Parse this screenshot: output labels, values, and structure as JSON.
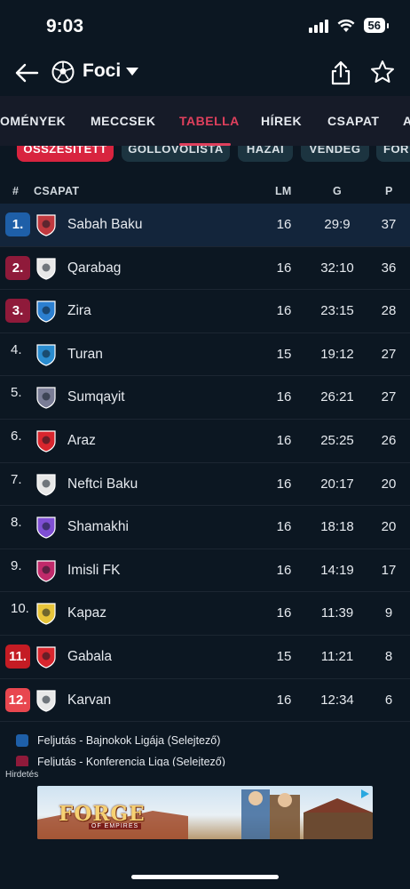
{
  "status_bar": {
    "time": "9:03",
    "battery": "56"
  },
  "header": {
    "title": "Foci"
  },
  "tabs": [
    {
      "label": "OMÉNYEK"
    },
    {
      "label": "MECCSEK"
    },
    {
      "label": "TABELLA"
    },
    {
      "label": "HÍREK"
    },
    {
      "label": "CSAPAT"
    },
    {
      "label": "A"
    }
  ],
  "chips": [
    {
      "label": "ÖSSZESÍTETT"
    },
    {
      "label": "GÓLLÖVŐLISTA"
    },
    {
      "label": "HAZAI"
    },
    {
      "label": "VENDÉG"
    },
    {
      "label": "FOR"
    }
  ],
  "table": {
    "headers": {
      "rank": "#",
      "team": "CSAPAT",
      "played": "LM",
      "goals": "G",
      "points": "P"
    },
    "rows": [
      {
        "pos": "1.",
        "team": "Sabah Baku",
        "lm": "16",
        "g": "29:9",
        "p": "37",
        "badge_color": "#1e5fa8",
        "highlight": true
      },
      {
        "pos": "2.",
        "team": "Qarabag",
        "lm": "16",
        "g": "32:10",
        "p": "36",
        "badge_color": "#8f1a3a"
      },
      {
        "pos": "3.",
        "team": "Zira",
        "lm": "16",
        "g": "23:15",
        "p": "28",
        "badge_color": "#8f1a3a"
      },
      {
        "pos": "4.",
        "team": "Turan",
        "lm": "15",
        "g": "19:12",
        "p": "27"
      },
      {
        "pos": "5.",
        "team": "Sumqayit",
        "lm": "16",
        "g": "26:21",
        "p": "27"
      },
      {
        "pos": "6.",
        "team": "Araz",
        "lm": "16",
        "g": "25:25",
        "p": "26"
      },
      {
        "pos": "7.",
        "team": "Neftci Baku",
        "lm": "16",
        "g": "20:17",
        "p": "20"
      },
      {
        "pos": "8.",
        "team": "Shamakhi",
        "lm": "16",
        "g": "18:18",
        "p": "20"
      },
      {
        "pos": "9.",
        "team": "Imisli FK",
        "lm": "16",
        "g": "14:19",
        "p": "17"
      },
      {
        "pos": "10.",
        "team": "Kapaz",
        "lm": "16",
        "g": "11:39",
        "p": "9"
      },
      {
        "pos": "11.",
        "team": "Gabala",
        "lm": "15",
        "g": "11:21",
        "p": "8",
        "badge_color": "#c41c24"
      },
      {
        "pos": "12.",
        "team": "Karvan",
        "lm": "16",
        "g": "12:34",
        "p": "6",
        "badge_color": "#e8474f"
      }
    ]
  },
  "legend": [
    {
      "label": "Feljutás - Bajnokok Ligája (Selejtező)",
      "color": "#1e5fa8"
    },
    {
      "label": "Feljutás - Konferencia Liga (Selejtező)",
      "color": "#8f1a3a"
    }
  ],
  "ad": {
    "label": "Hirdetés",
    "title": "FORGE",
    "subtitle": "OF EMPIRES"
  }
}
